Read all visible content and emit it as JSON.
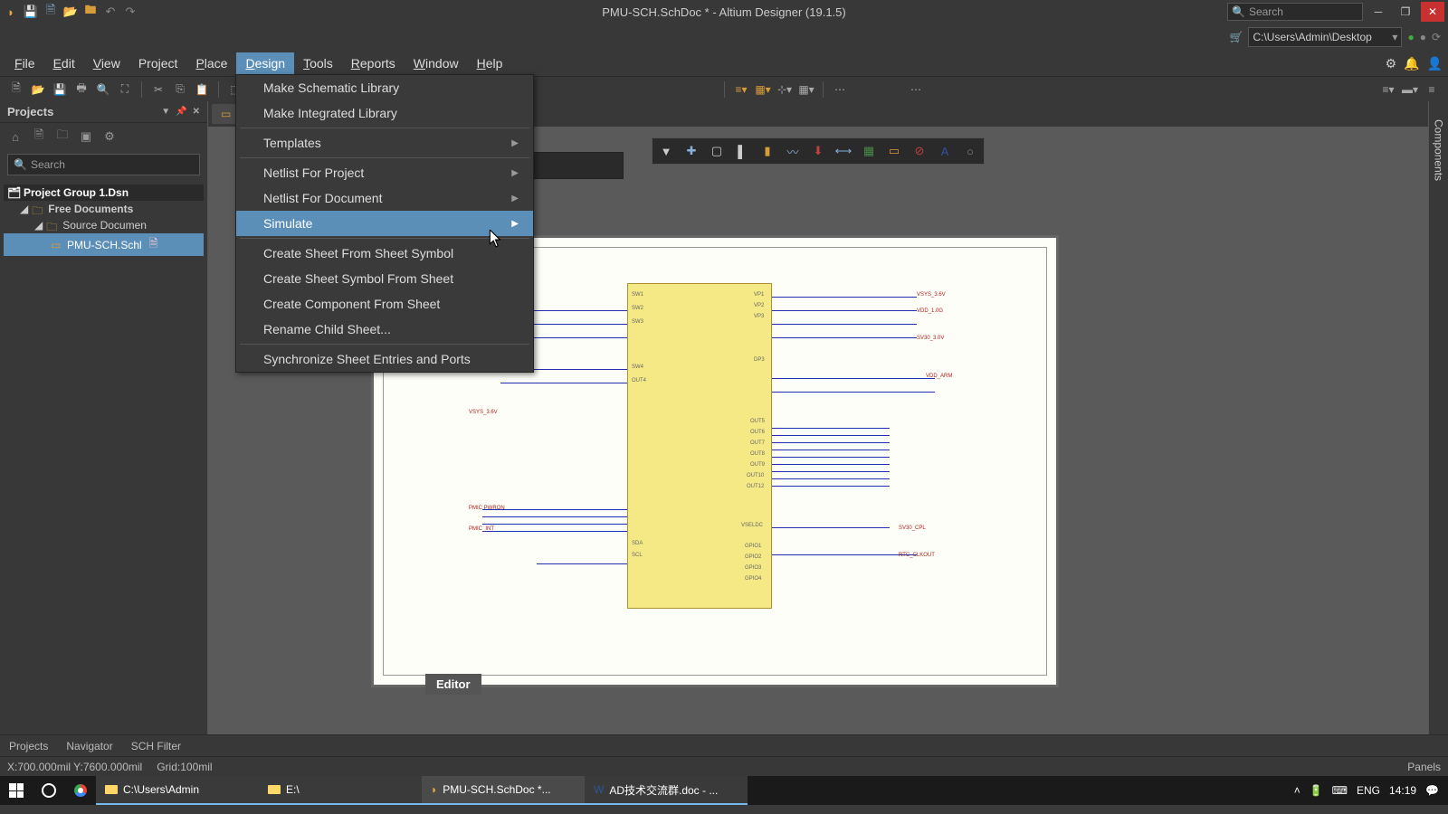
{
  "title": "PMU-SCH.SchDoc * - Altium Designer (19.1.5)",
  "search_placeholder": "Search",
  "path": "C:\\Users\\Admin\\Desktop",
  "menubar": [
    "File",
    "Edit",
    "View",
    "Project",
    "Place",
    "Design",
    "Tools",
    "Reports",
    "Window",
    "Help"
  ],
  "active_menu": "Design",
  "dropdown": {
    "items": [
      {
        "label": "Make Schematic Library",
        "submenu": false
      },
      {
        "label": "Make Integrated Library",
        "submenu": false
      },
      {
        "label": "Templates",
        "submenu": true
      },
      {
        "label": "Netlist For Project",
        "submenu": true
      },
      {
        "label": "Netlist For Document",
        "submenu": true
      },
      {
        "label": "Simulate",
        "submenu": true,
        "highlighted": true
      },
      {
        "label": "Create Sheet From Sheet Symbol",
        "submenu": false
      },
      {
        "label": "Create Sheet Symbol From Sheet",
        "submenu": false
      },
      {
        "label": "Create Component From Sheet",
        "submenu": false
      },
      {
        "label": "Rename Child Sheet...",
        "submenu": false
      },
      {
        "label": "Synchronize Sheet Entries and Ports",
        "submenu": false
      }
    ],
    "separators_after": [
      1,
      2,
      5,
      10
    ]
  },
  "sidebar": {
    "title": "Projects",
    "search_placeholder": "Search",
    "tree": {
      "root": "Project Group 1.Dsn",
      "free_docs": "Free Documents",
      "source_docs": "Source Documen",
      "file": "PMU-SCH.Schl"
    }
  },
  "right_panel": "Components",
  "bottom_tabs": [
    "Projects",
    "Navigator",
    "SCH Filter"
  ],
  "editor_tab": "Editor",
  "statusbar": {
    "coords": "X:700.000mil Y:7600.000mil",
    "grid": "Grid:100mil",
    "panels": "Panels"
  },
  "taskbar": {
    "items": [
      {
        "label": "C:\\Users\\Admin",
        "icon": "folder"
      },
      {
        "label": "E:\\",
        "icon": "folder"
      },
      {
        "label": "PMU-SCH.SchDoc *...",
        "icon": "altium",
        "active": true
      },
      {
        "label": "AD技术交流群.doc - ...",
        "icon": "word"
      }
    ],
    "lang": "ENG",
    "time": "14:19"
  }
}
